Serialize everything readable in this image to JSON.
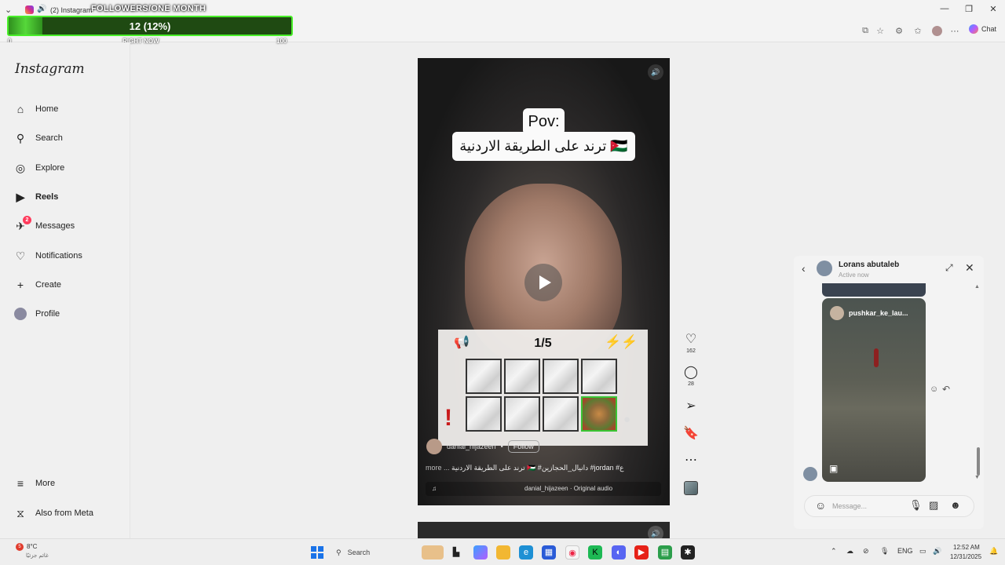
{
  "browser": {
    "tab_title": "(2) Instagram",
    "chat_label": "Chat"
  },
  "followers_overlay": {
    "title": "FOLLOWERS/ONE MONTH",
    "count_text": "12 (12%)",
    "progress_fraction": 0.12,
    "min_label": "0",
    "now_label": "RIGHT NOW",
    "max_label": "100"
  },
  "sidebar": {
    "logo": "Instagram",
    "items": [
      {
        "label": "Home",
        "icon": "home-icon"
      },
      {
        "label": "Search",
        "icon": "search-icon"
      },
      {
        "label": "Explore",
        "icon": "compass-icon"
      },
      {
        "label": "Reels",
        "icon": "reels-icon"
      },
      {
        "label": "Messages",
        "icon": "messenger-icon",
        "badge": "2"
      },
      {
        "label": "Notifications",
        "icon": "heart-icon"
      },
      {
        "label": "Create",
        "icon": "plus-icon"
      },
      {
        "label": "Profile",
        "icon": "avatar"
      }
    ],
    "more": "More",
    "also_meta": "Also from Meta"
  },
  "reel": {
    "pov_text": "Pov:",
    "arabic_caption": "ترند على الطريقة الاردنية 🇯🇴",
    "author": "danial_hijazeen",
    "dot": "•",
    "follow": "Follow",
    "caption_text": "ترند على الطريقة الاردنية 🇯🇴 #دانيال_الحجازين #jordan #ع",
    "caption_more": "more ...",
    "audio_text": "danial_hijazeen · Original audio",
    "likes": "162",
    "comments": "28"
  },
  "game": {
    "counter": "1/5",
    "tiles": [
      "blank",
      "blank",
      "blank",
      "blank",
      "blank",
      "blank",
      "blank",
      "found"
    ]
  },
  "messages_panel": {
    "name": "Lorans abutaleb",
    "status": "Active now",
    "shared_user": "pushkar_ke_lau...",
    "placeholder": "Message..."
  },
  "taskbar": {
    "weather_temp": "8°C",
    "weather_desc": "غائم جزئيًا",
    "weather_badge": "5",
    "search": "Search",
    "lang": "ENG",
    "time": "12:52 AM",
    "date": "12/31/2025"
  },
  "colors": {
    "progress_border": "#49ef29",
    "progress_fill": "#56d83a",
    "notification_badge": "#ff3b5c",
    "found_tile_border": "#39c534"
  }
}
